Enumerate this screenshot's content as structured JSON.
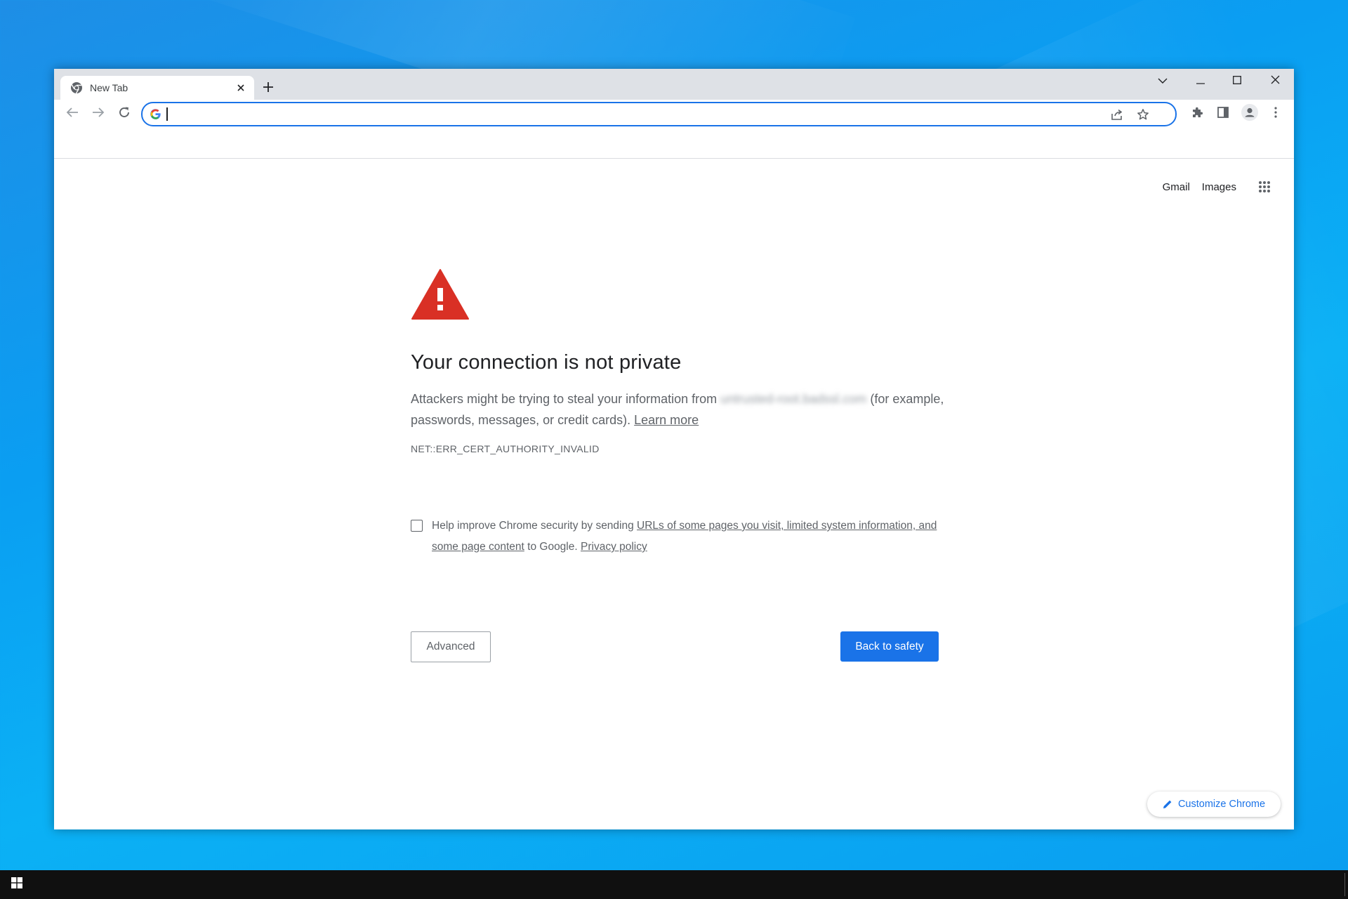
{
  "browser": {
    "tab": {
      "title": "New Tab",
      "icon": "chrome-icon"
    },
    "new_tab_icon": "plus-icon",
    "window_controls": [
      "tab-search-icon",
      "minimize-icon",
      "maximize-icon",
      "close-icon"
    ],
    "omnibox": {
      "value": "",
      "placeholder": ""
    },
    "toolbar_icons": [
      "back-icon",
      "forward-icon",
      "reload-icon",
      "share-icon",
      "star-icon",
      "extensions-icon",
      "side-panel-icon",
      "profile-icon",
      "menu-icon"
    ]
  },
  "ntp_header": {
    "gmail": "Gmail",
    "images": "Images",
    "apps_icon": "apps-grid-icon"
  },
  "interstitial": {
    "heading": "Your connection is not private",
    "body_prefix": "Attackers might be trying to steal your information from",
    "host_blurred": "untrusted-root.badssl.com",
    "body_suffix": "(for example, passwords, messages, or credit cards).",
    "learn_more": "Learn more",
    "error_code": "NET::ERR_CERT_AUTHORITY_INVALID",
    "optin_prefix": "Help improve Chrome security by sending",
    "optin_link": "URLs of some pages you visit, limited system information, and some page content",
    "optin_middle": "to Google.",
    "privacy_link": "Privacy policy",
    "optin_checked": false,
    "advanced_button": "Advanced",
    "back_button": "Back to safety"
  },
  "customize": {
    "label": "Customize Chrome",
    "icon": "pencil-icon"
  },
  "colors": {
    "accent": "#1a73e8",
    "warning": "#d93025",
    "text": "#202124",
    "muted": "#5f6368",
    "frame": "#dee1e6"
  }
}
